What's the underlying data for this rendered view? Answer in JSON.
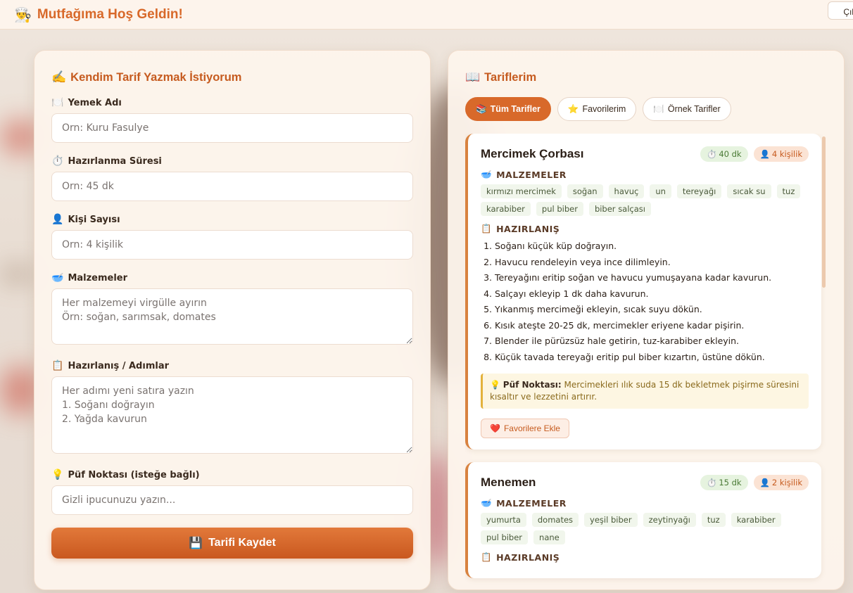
{
  "app": {
    "brand_icon": "chef-icon",
    "title": "Mutfağıma Hoş Geldin!",
    "logout_label": "Çıkış"
  },
  "form": {
    "title": "Kendim Tarif Yazmak İstiyorum",
    "title_icon": "writing-hand-icon",
    "fields": {
      "name": {
        "label": "Yemek Adı",
        "icon": "plate-icon",
        "placeholder": "Örn: Kuru Fasulye"
      },
      "duration": {
        "label": "Hazırlanma Süresi",
        "icon": "stopwatch-icon",
        "placeholder": "Örn: 45 dk"
      },
      "servings": {
        "label": "Kişi Sayısı",
        "icon": "person-icon",
        "placeholder": "Örn: 4 kişilik"
      },
      "ingredients": {
        "label": "Malzemeler",
        "icon": "bowl-icon",
        "placeholder": "Her malzemeyi virgülle ayırın\nÖrn: soğan, sarımsak, domates"
      },
      "steps": {
        "label": "Hazırlanış / Adımlar",
        "icon": "clipboard-icon",
        "placeholder": "Her adımı yeni satıra yazın\n1. Soğanı doğrayın\n2. Yağda kavurun"
      },
      "tip": {
        "label": "Püf Noktası (isteğe bağlı)",
        "icon": "lightbulb-icon",
        "placeholder": "Gizli ipucunuzu yazın..."
      }
    },
    "save_label": "Tarifi Kaydet",
    "save_icon": "floppy-icon"
  },
  "recipes_panel": {
    "title": "Tariflerim",
    "title_icon": "book-icon",
    "tabs": [
      {
        "label": "Tüm Tarifler",
        "icon": "books-icon",
        "active": true
      },
      {
        "label": "Favorilerim",
        "icon": "star-icon",
        "active": false
      },
      {
        "label": "Örnek Tarifler",
        "icon": "plate-icon",
        "active": false
      }
    ],
    "ingredients_heading": "MALZEMELER",
    "steps_heading": "HAZIRLANIŞ",
    "tip_label": "Püf Noktası:",
    "fav_label": "Favorilere Ekle",
    "recipes": [
      {
        "title": "Mercimek Çorbası",
        "time": "40 dk",
        "servings": "4 kişilik",
        "ingredients": [
          "kırmızı mercimek",
          "soğan",
          "havuç",
          "un",
          "tereyağı",
          "sıcak su",
          "tuz",
          "karabiber",
          "pul biber",
          "biber salçası"
        ],
        "steps": [
          "Soğanı küçük küp doğrayın.",
          "Havucu rendeleyin veya ince dilimleyin.",
          "Tereyağını eritip soğan ve havucu yumuşayana kadar kavurun.",
          "Salçayı ekleyip 1 dk daha kavurun.",
          "Yıkanmış mercimeği ekleyin, sıcak suyu dökün.",
          "Kısık ateşte 20-25 dk, mercimekler eriyene kadar pişirin.",
          "Blender ile pürüzsüz hale getirin, tuz-karabiber ekleyin.",
          "Küçük tavada tereyağı eritip pul biber kızartın, üstüne dökün."
        ],
        "tip": "Mercimekleri ılık suda 15 dk bekletmek pişirme süresini kısaltır ve lezzetini artırır."
      },
      {
        "title": "Menemen",
        "time": "15 dk",
        "servings": "2 kişilik",
        "ingredients": [
          "yumurta",
          "domates",
          "yeşil biber",
          "zeytinyağı",
          "tuz",
          "karabiber",
          "pul biber",
          "nane"
        ]
      }
    ]
  }
}
